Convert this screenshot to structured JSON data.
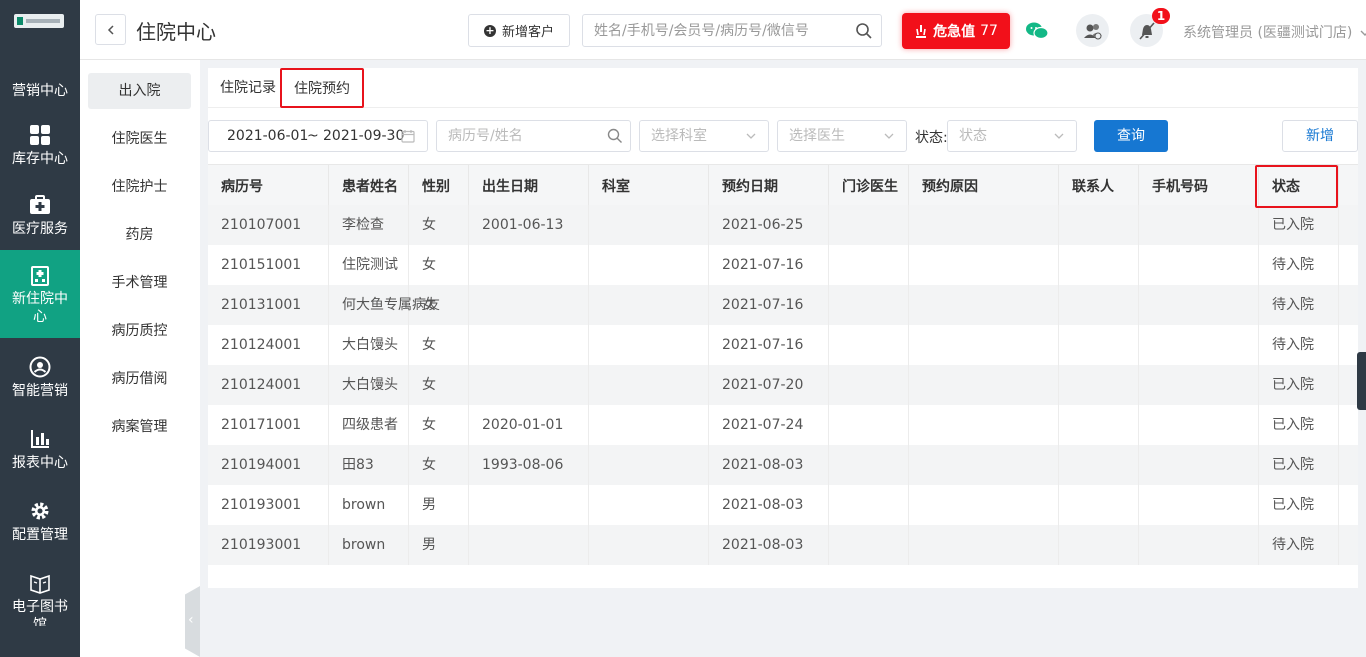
{
  "nav": {
    "items": [
      {
        "label": "营销中心",
        "icon": "megaphone-icon"
      },
      {
        "label": "库存中心",
        "icon": "grid-icon"
      },
      {
        "label": "医疗服务",
        "icon": "medkit-icon"
      },
      {
        "label": "新住院中心",
        "icon": "hospital-icon"
      },
      {
        "label": "智能营销",
        "icon": "user-circle-icon"
      },
      {
        "label": "报表中心",
        "icon": "bar-chart-icon"
      },
      {
        "label": "配置管理",
        "icon": "gear-icon"
      },
      {
        "label": "电子图书馆",
        "icon": "book-icon"
      }
    ],
    "active_index": 3
  },
  "header": {
    "title": "住院中心",
    "new_customer_label": "新增客户",
    "search_placeholder": "姓名/手机号/会员号/病历号/微信号",
    "critical_label": "危急值",
    "critical_count": "77",
    "notification_count": "1",
    "user_label": "系统管理员 (医疆测试门店)"
  },
  "submenu": {
    "items": [
      "出入院",
      "住院医生",
      "住院护士",
      "药房",
      "手术管理",
      "病历质控",
      "病历借阅",
      "病案管理"
    ],
    "active_index": 0
  },
  "tabs": {
    "records": "住院记录",
    "booking": "住院预约"
  },
  "filters": {
    "date_start": "2021-06-01",
    "date_sep": "~",
    "date_end": "2021-09-30",
    "patient_placeholder": "病历号/姓名",
    "dept_placeholder": "选择科室",
    "doctor_placeholder": "选择医生",
    "status_label": "状态:",
    "status_placeholder": "状态",
    "query_label": "查询",
    "add_label": "新增"
  },
  "table": {
    "columns": [
      "病历号",
      "患者姓名",
      "性别",
      "出生日期",
      "科室",
      "预约日期",
      "门诊医生",
      "预约原因",
      "联系人",
      "手机号码",
      "状态"
    ],
    "rows": [
      [
        "210107001",
        "李检查",
        "女",
        "2001-06-13",
        "",
        "2021-06-25",
        "",
        "",
        "",
        "",
        "已入院"
      ],
      [
        "210151001",
        "住院测试",
        "女",
        "",
        "",
        "2021-07-16",
        "",
        "",
        "",
        "",
        "待入院"
      ],
      [
        "210131001",
        "何大鱼专属病友",
        "女",
        "",
        "",
        "2021-07-16",
        "",
        "",
        "",
        "",
        "待入院"
      ],
      [
        "210124001",
        "大白馒头",
        "女",
        "",
        "",
        "2021-07-16",
        "",
        "",
        "",
        "",
        "待入院"
      ],
      [
        "210124001",
        "大白馒头",
        "女",
        "",
        "",
        "2021-07-20",
        "",
        "",
        "",
        "",
        "已入院"
      ],
      [
        "210171001",
        "四级患者",
        "女",
        "2020-01-01",
        "",
        "2021-07-24",
        "",
        "",
        "",
        "",
        "已入院"
      ],
      [
        "210194001",
        "田83",
        "女",
        "1993-08-06",
        "",
        "2021-08-03",
        "",
        "",
        "",
        "",
        "已入院"
      ],
      [
        "210193001",
        "brown",
        "男",
        "",
        "",
        "2021-08-03",
        "",
        "",
        "",
        "",
        "已入院"
      ],
      [
        "210193001",
        "brown",
        "男",
        "",
        "",
        "2021-08-03",
        "",
        "",
        "",
        "",
        "待入院"
      ]
    ]
  },
  "colors": {
    "nav_bg": "#2f3a45",
    "nav_active": "#11a283",
    "critical": "#f2101a",
    "primary": "#1677d2",
    "highlight_border": "#e8131c"
  }
}
